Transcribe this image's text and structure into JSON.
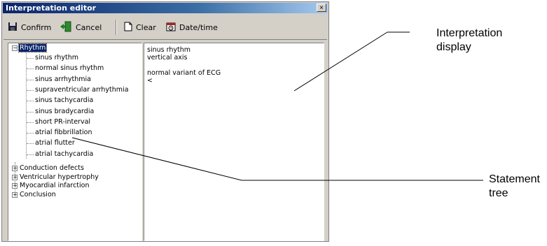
{
  "window": {
    "title": "Interpretation editor",
    "close_glyph": "×"
  },
  "toolbar": {
    "confirm": "Confirm",
    "cancel": "Cancel",
    "clear": "Clear",
    "datetime": "Date/time"
  },
  "tree": {
    "root_label": "Rhythm",
    "root_expander": "−",
    "rhythm_children": [
      "sinus rhythm",
      "normal sinus rhythm",
      "sinus arrhythmia",
      "supraventricular arrhythmia",
      "sinus tachycardia",
      "sinus bradycardia",
      "short PR-interval",
      "atrial fibbrillation",
      "atrial flutter",
      "atrial tachycardia"
    ],
    "collapsed_nodes": [
      "Conduction defects",
      "Ventricular hypertrophy",
      "Myocardial infarction",
      "Conclusion"
    ],
    "collapsed_expander": "+"
  },
  "interpretation": {
    "lines": [
      "sinus rhythm",
      "vertical axis",
      "",
      "normal variant of ECG",
      "<"
    ]
  },
  "callouts": {
    "display": [
      "Interpretation",
      "display"
    ],
    "tree": "Statement tree"
  }
}
